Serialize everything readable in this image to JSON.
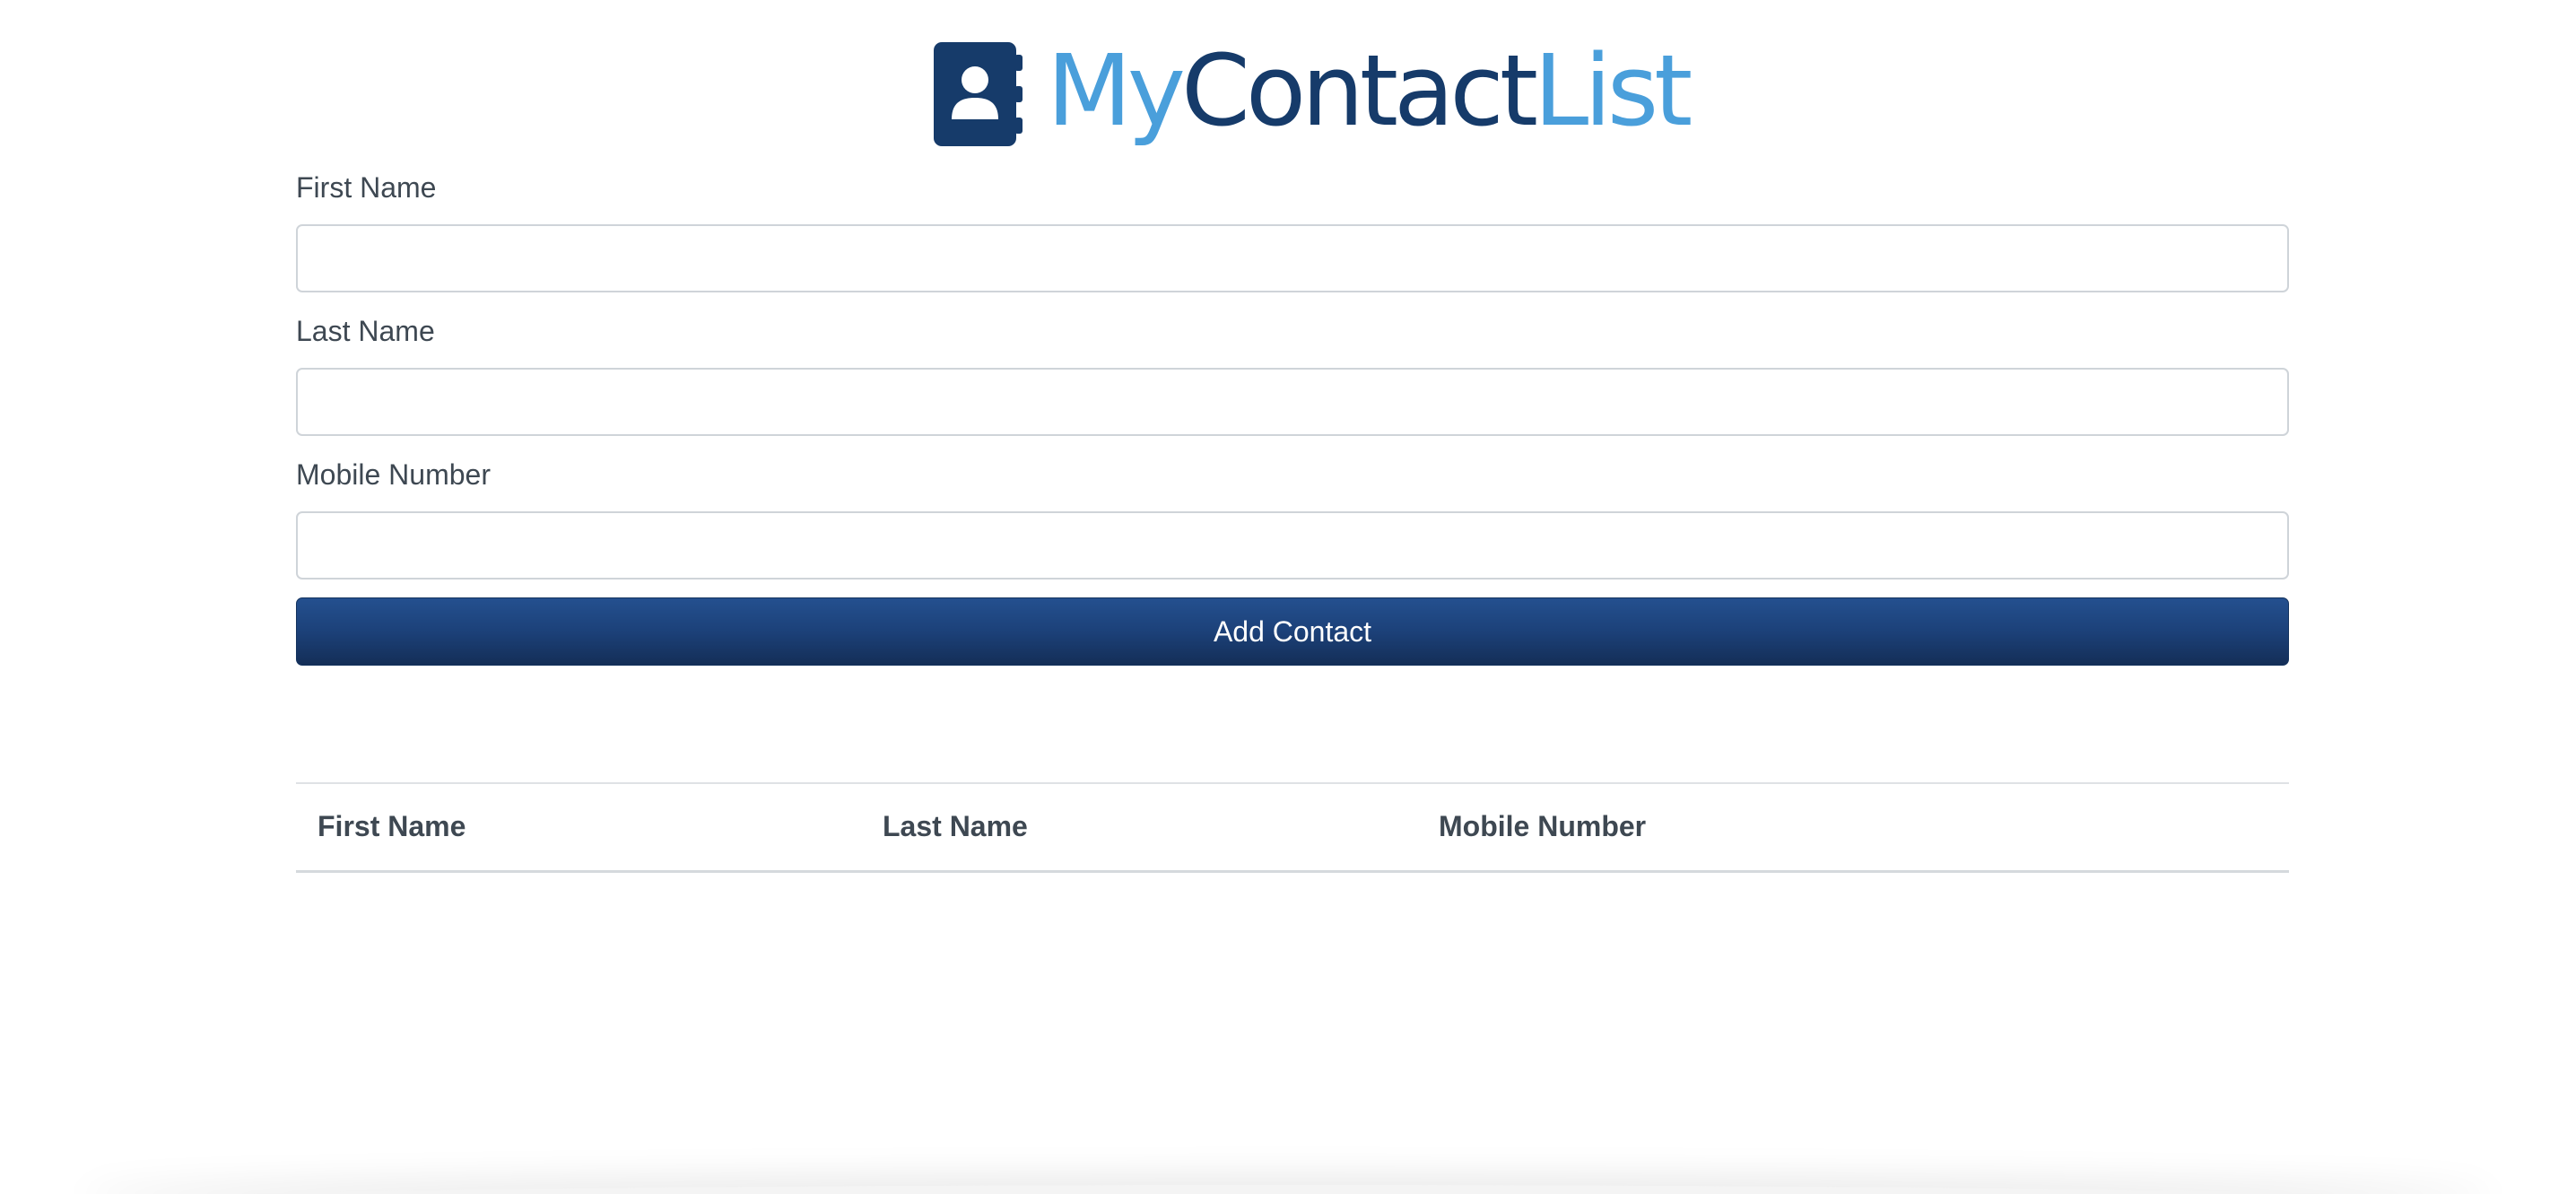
{
  "header": {
    "logo_part1": "My",
    "logo_part2": "Contact",
    "logo_part3": "List",
    "logo_icon": "address-book-icon",
    "colors": {
      "light_blue": "#4a9fdb",
      "dark_blue": "#163b6a"
    }
  },
  "form": {
    "first_name_label": "First Name",
    "first_name_value": "",
    "last_name_label": "Last Name",
    "last_name_value": "",
    "mobile_label": "Mobile Number",
    "mobile_value": "",
    "add_button_label": "Add Contact",
    "button_color": "#1c4179"
  },
  "table": {
    "columns": [
      "First Name",
      "Last Name",
      "Mobile Number"
    ],
    "rows": []
  }
}
